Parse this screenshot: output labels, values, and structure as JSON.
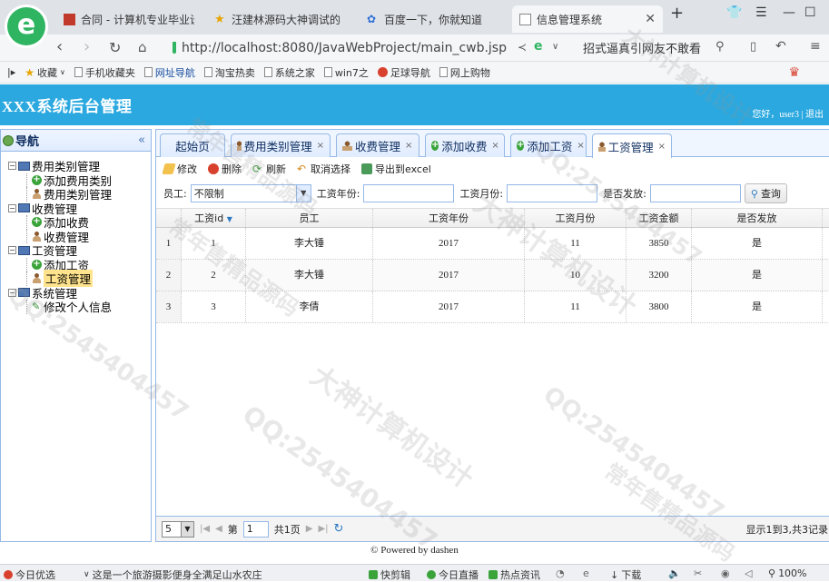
{
  "browser": {
    "tabs": [
      {
        "label": "合同 - 计算机专业毕业设",
        "fav_color": "#c0392b"
      },
      {
        "label": "汪建林源码大神调试的QQ",
        "fav_color": "#e8a400"
      },
      {
        "label": "百度一下，你就知道",
        "fav_color": "#2f6fd6"
      },
      {
        "label": "信息管理系统",
        "fav_color": "#888888",
        "active": true
      }
    ],
    "url": "http://localhost:8080/JavaWebProject/main_cwb.jsp",
    "search_placeholder": "招式逼真引网友不敢看",
    "bookmarks": [
      "收藏",
      "手机收藏夹",
      "网址导航",
      "淘宝热卖",
      "系统之家",
      "win7之",
      "足球导航",
      "网上购物"
    ]
  },
  "app": {
    "title": "XXX系统后台管理",
    "user_text": "您好，user3 | 退出",
    "nav_title": "导航",
    "tree": [
      {
        "label": "费用类别管理",
        "level": 1,
        "icon": "folder"
      },
      {
        "label": "添加费用类别",
        "level": 2,
        "icon": "add"
      },
      {
        "label": "费用类别管理",
        "level": 2,
        "icon": "user"
      },
      {
        "label": "收费管理",
        "level": 1,
        "icon": "folder"
      },
      {
        "label": "添加收费",
        "level": 2,
        "icon": "add"
      },
      {
        "label": "收费管理",
        "level": 2,
        "icon": "user"
      },
      {
        "label": "工资管理",
        "level": 1,
        "icon": "folder"
      },
      {
        "label": "添加工资",
        "level": 2,
        "icon": "add"
      },
      {
        "label": "工资管理",
        "level": 2,
        "icon": "user",
        "selected": true
      },
      {
        "label": "系统管理",
        "level": 1,
        "icon": "folder"
      },
      {
        "label": "修改个人信息",
        "level": 2,
        "icon": "pencil"
      }
    ],
    "panel_tabs": [
      {
        "label": "起始页",
        "closable": false
      },
      {
        "label": "费用类别管理",
        "closable": true,
        "icon": "user"
      },
      {
        "label": "收费管理",
        "closable": true,
        "icon": "user"
      },
      {
        "label": "添加收费",
        "closable": true,
        "icon": "add"
      },
      {
        "label": "添加工资",
        "closable": true,
        "icon": "add"
      },
      {
        "label": "工资管理",
        "closable": true,
        "icon": "user",
        "active": true
      }
    ],
    "toolbar": {
      "edit": "修改",
      "delete": "删除",
      "refresh": "刷新",
      "unselect": "取消选择",
      "export": "导出到excel"
    },
    "filter": {
      "employee_label": "员工:",
      "employee_value": "不限制",
      "year_label": "工资年份:",
      "month_label": "工资月份:",
      "paid_label": "是否发放:",
      "query_button": "查询"
    },
    "grid": {
      "columns": [
        "工资id",
        "员工",
        "工资年份",
        "工资月份",
        "工资金额",
        "是否发放"
      ],
      "rows": [
        {
          "rn": "1",
          "id": "1",
          "employee": "李大锤",
          "year": "2017",
          "month": "11",
          "amount": "3850",
          "paid": "是"
        },
        {
          "rn": "2",
          "id": "2",
          "employee": "李大锤",
          "year": "2017",
          "month": "10",
          "amount": "3200",
          "paid": "是"
        },
        {
          "rn": "3",
          "id": "3",
          "employee": "李倩",
          "year": "2017",
          "month": "11",
          "amount": "3800",
          "paid": "是"
        }
      ]
    },
    "pager": {
      "page_size": "5",
      "page_prefix": "第",
      "page_value": "1",
      "page_suffix": "共1页",
      "info": "显示1到3,共3记录"
    },
    "footer": "© Powered by dashen"
  },
  "statusbar": {
    "items": [
      "今日优选",
      "这是一个旅游摄影便身全满足山水农庄",
      "快剪辑",
      "今日直播",
      "热点资讯",
      "下载",
      "100%"
    ]
  },
  "watermarks": [
    "大神计算机设计",
    "QQ:2545404457",
    "常年售精品源码",
    "大神计算机设计",
    "QQ:2545404457",
    "常年售精品源码"
  ]
}
